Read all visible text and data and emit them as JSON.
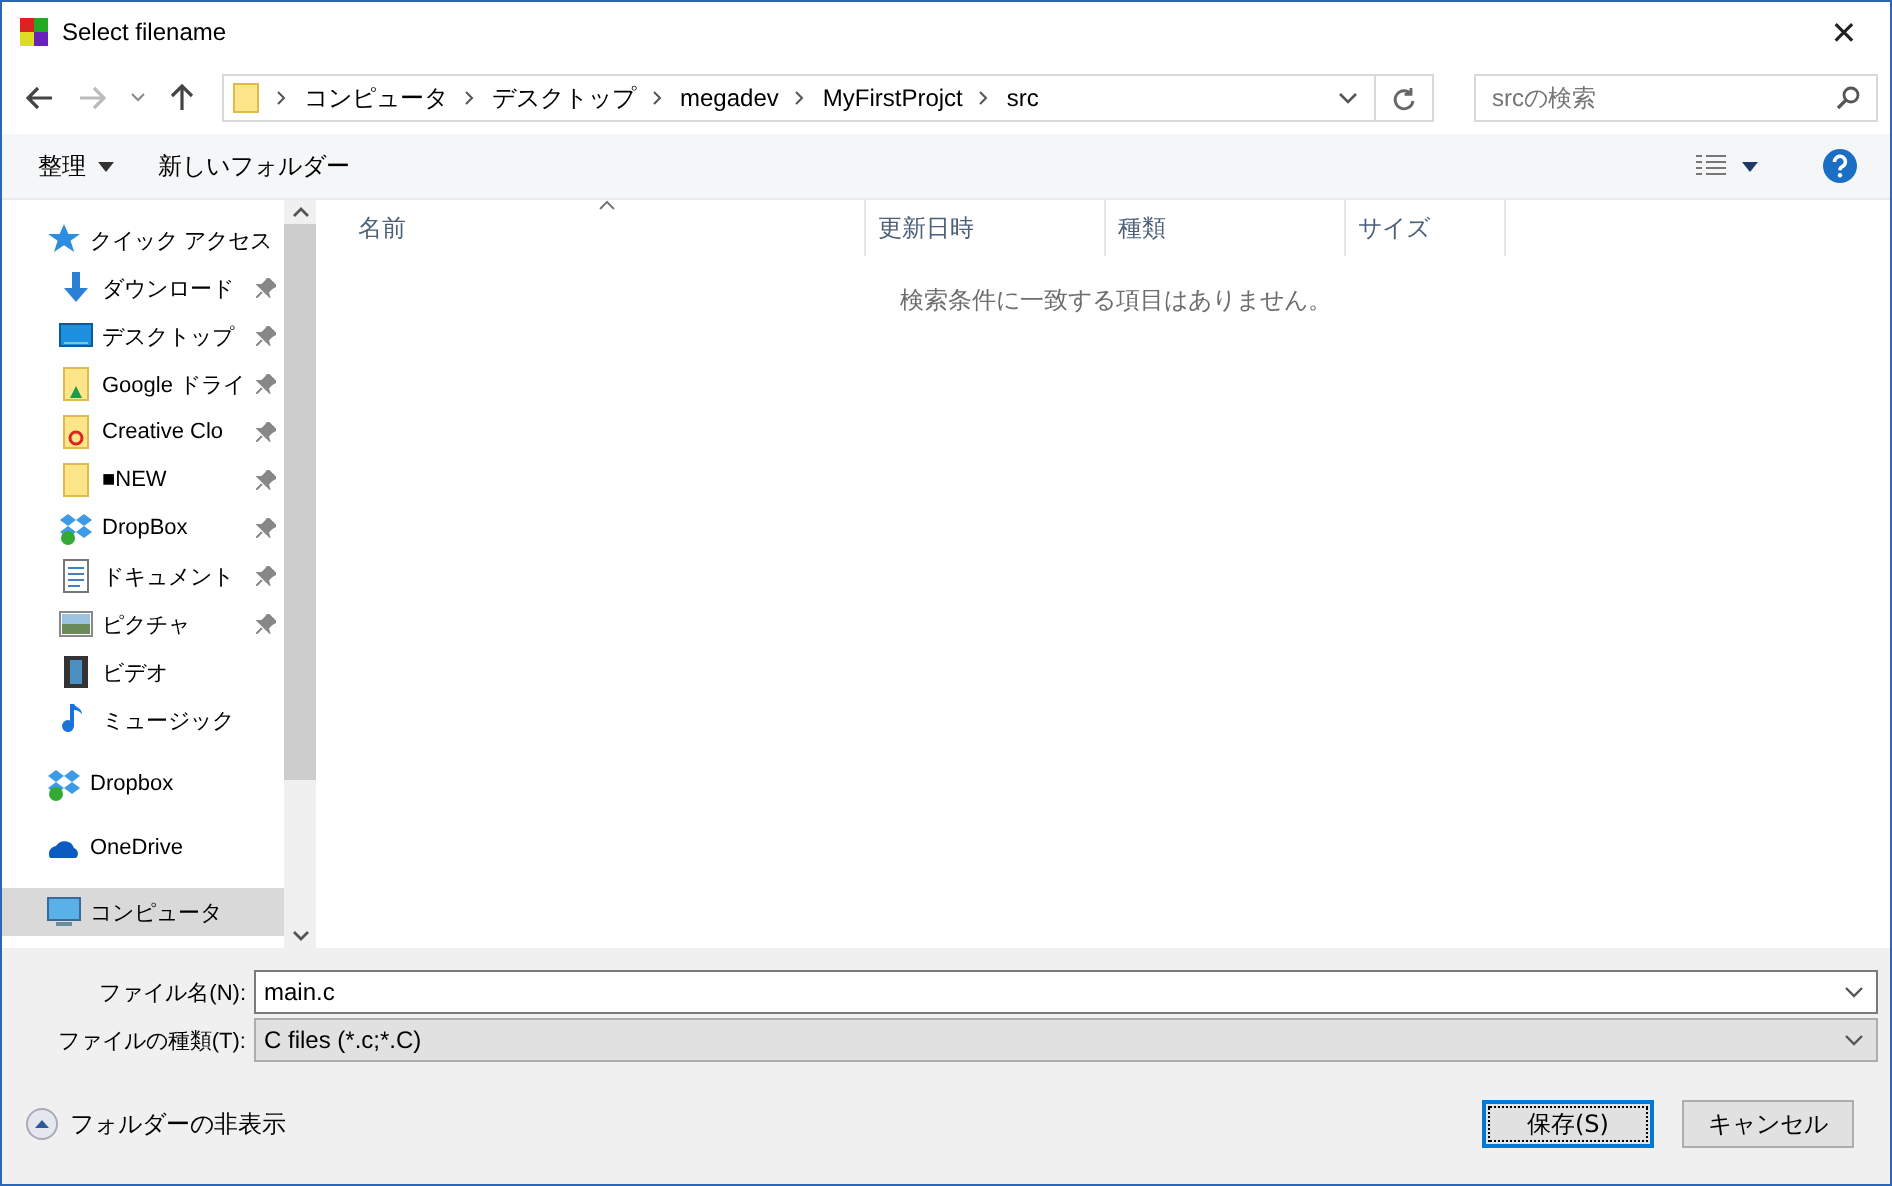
{
  "window": {
    "title": "Select filename",
    "close": "✕"
  },
  "breadcrumb": [
    "コンピュータ",
    "デスクトップ",
    "megadev",
    "MyFirstProjct",
    "src"
  ],
  "search": {
    "placeholder": "srcの検索"
  },
  "toolbar": {
    "organize": "整理",
    "new_folder": "新しいフォルダー"
  },
  "sidebar": {
    "items": [
      {
        "label": "クイック アクセス",
        "kind": "star",
        "selected": false,
        "children": [
          {
            "label": "ダウンロード",
            "kind": "download",
            "pinned": true,
            "selected": false
          },
          {
            "label": "デスクトップ",
            "kind": "desktop",
            "pinned": true,
            "selected": false
          },
          {
            "label": "Google ドライ",
            "kind": "gdrive",
            "pinned": true,
            "selected": false
          },
          {
            "label": "Creative Clo",
            "kind": "creative",
            "pinned": true,
            "selected": false
          },
          {
            "label": "■NEW",
            "kind": "folder",
            "pinned": true,
            "selected": false
          },
          {
            "label": "DropBox",
            "kind": "dropbox",
            "pinned": true,
            "selected": false
          },
          {
            "label": "ドキュメント",
            "kind": "document",
            "pinned": true,
            "selected": false
          },
          {
            "label": "ピクチャ",
            "kind": "picture",
            "pinned": true,
            "selected": false
          },
          {
            "label": "ビデオ",
            "kind": "video",
            "pinned": false,
            "selected": false
          },
          {
            "label": "ミュージック",
            "kind": "music",
            "pinned": false,
            "selected": false
          }
        ]
      },
      {
        "label": "Dropbox",
        "kind": "dropbox",
        "selected": false
      },
      {
        "label": "OneDrive",
        "kind": "cloud",
        "selected": false
      },
      {
        "label": "コンピュータ",
        "kind": "computer",
        "selected": true
      }
    ]
  },
  "table": {
    "columns": [
      "名前",
      "更新日時",
      "種類",
      "サイズ"
    ],
    "empty_message": "検索条件に一致する項目はありません。"
  },
  "form": {
    "filename_label": "ファイル名(N):",
    "filename": "main.c",
    "filetype_label": "ファイルの種類(T):",
    "filetype": "C files (*.c;*.C)"
  },
  "hide_folders": "フォルダーの非表示",
  "buttons": [
    {
      "label": "保存(S)",
      "kind": "default"
    },
    {
      "label": "キャンセル",
      "kind": "normal"
    }
  ]
}
